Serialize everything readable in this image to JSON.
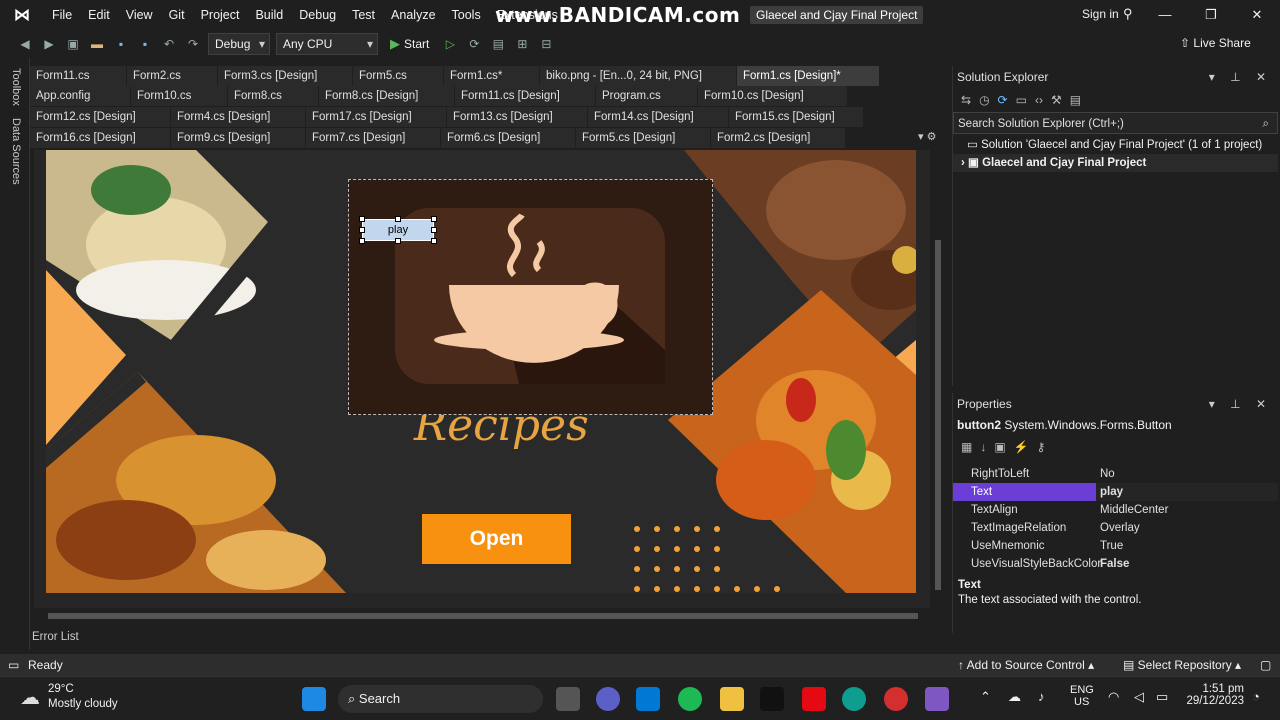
{
  "window": {
    "title": "Glaecel and Cjay Final Project",
    "menu": [
      "File",
      "Edit",
      "View",
      "Git",
      "Project",
      "Build",
      "Debug",
      "Test",
      "Analyze",
      "Tools",
      "Extensions"
    ],
    "watermark": "www.BANDICAM.com",
    "sign_in": "Sign in",
    "controls": [
      "—",
      "❐",
      "✕"
    ]
  },
  "toolbar": {
    "config": "Debug",
    "platform": "Any CPU",
    "start": "Start",
    "live_share": "Live Share"
  },
  "side_tabs": [
    "Toolbox",
    "Data Sources"
  ],
  "doc_tabs": {
    "row1": [
      "Form11.cs",
      "Form2.cs",
      "Form3.cs [Design]",
      "Form5.cs",
      "Form1.cs*",
      "biko.png - [En...0, 24 bit, PNG]",
      "Form1.cs [Design]*"
    ],
    "row2": [
      "App.config",
      "Form10.cs",
      "Form8.cs",
      "Form8.cs [Design]",
      "Form11.cs [Design]",
      "Program.cs",
      "Form10.cs [Design]"
    ],
    "row3": [
      "Form12.cs [Design]",
      "Form4.cs [Design]",
      "Form17.cs [Design]",
      "Form13.cs [Design]",
      "Form14.cs [Design]",
      "Form15.cs [Design]"
    ],
    "row4": [
      "Form16.cs [Design]",
      "Form9.cs [Design]",
      "Form7.cs [Design]",
      "Form6.cs [Design]",
      "Form5.cs [Design]",
      "Form2.cs [Design]"
    ]
  },
  "form": {
    "play_button": "play",
    "heading": "Recipes",
    "open_button": "Open",
    "accent": "#f7910f"
  },
  "bottom": {
    "error_list": "Error List",
    "status": "Ready",
    "add_source": "Add to Source Control",
    "select_repo": "Select Repository"
  },
  "solution_explorer": {
    "title": "Solution Explorer",
    "search_placeholder": "Search Solution Explorer (Ctrl+;)",
    "solution": "Solution 'Glaecel and Cjay Final Project' (1 of 1 project)",
    "project": "Glaecel and Cjay Final Project"
  },
  "properties": {
    "title": "Properties",
    "object": "button2",
    "object_type": "System.Windows.Forms.Button",
    "rows": [
      {
        "name": "RightToLeft",
        "value": "No"
      },
      {
        "name": "Text",
        "value": "play"
      },
      {
        "name": "TextAlign",
        "value": "MiddleCenter"
      },
      {
        "name": "TextImageRelation",
        "value": "Overlay"
      },
      {
        "name": "UseMnemonic",
        "value": "True"
      },
      {
        "name": "UseVisualStyleBackColor",
        "value": "False"
      }
    ],
    "desc_title": "Text",
    "desc": "The text associated with the control."
  },
  "taskbar": {
    "temp": "29°C",
    "weather": "Mostly cloudy",
    "search": "Search",
    "lang1": "ENG",
    "lang2": "US",
    "time": "1:51 pm",
    "date": "29/12/2023"
  }
}
